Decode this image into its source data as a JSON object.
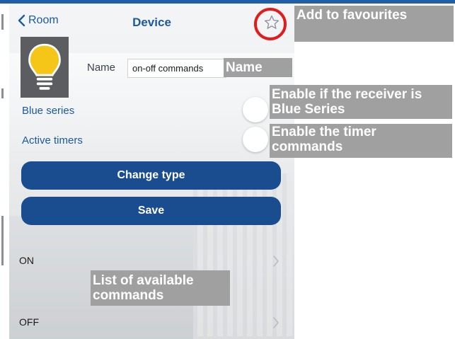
{
  "nav": {
    "back_label": "Room",
    "title": "Device"
  },
  "icons": {
    "back": "chevron-left-icon",
    "favourite": "star-outline-icon",
    "bulb": "light-bulb-icon",
    "chevron": "chevron-right-icon"
  },
  "device": {
    "name_label": "Name",
    "name_value": "on-off commands"
  },
  "settings": {
    "blue_series_label": "Blue series",
    "active_timers_label": "Active timers"
  },
  "buttons": {
    "change_type": "Change type",
    "save": "Save"
  },
  "commands": [
    {
      "label": "ON"
    },
    {
      "label": "OFF"
    }
  ],
  "callouts": {
    "favourites": "Add to favourites",
    "name": "Name",
    "blue_series": "Enable if the receiver is Blue Series",
    "timers": "Enable the timer commands",
    "commands": "List of available commands"
  },
  "colors": {
    "accent": "#1c5aa0",
    "button": "#1a4d8f",
    "callout_bg": "#a0a0a0",
    "highlight_ring": "#e21b1b",
    "bulb": "#f5c518"
  }
}
